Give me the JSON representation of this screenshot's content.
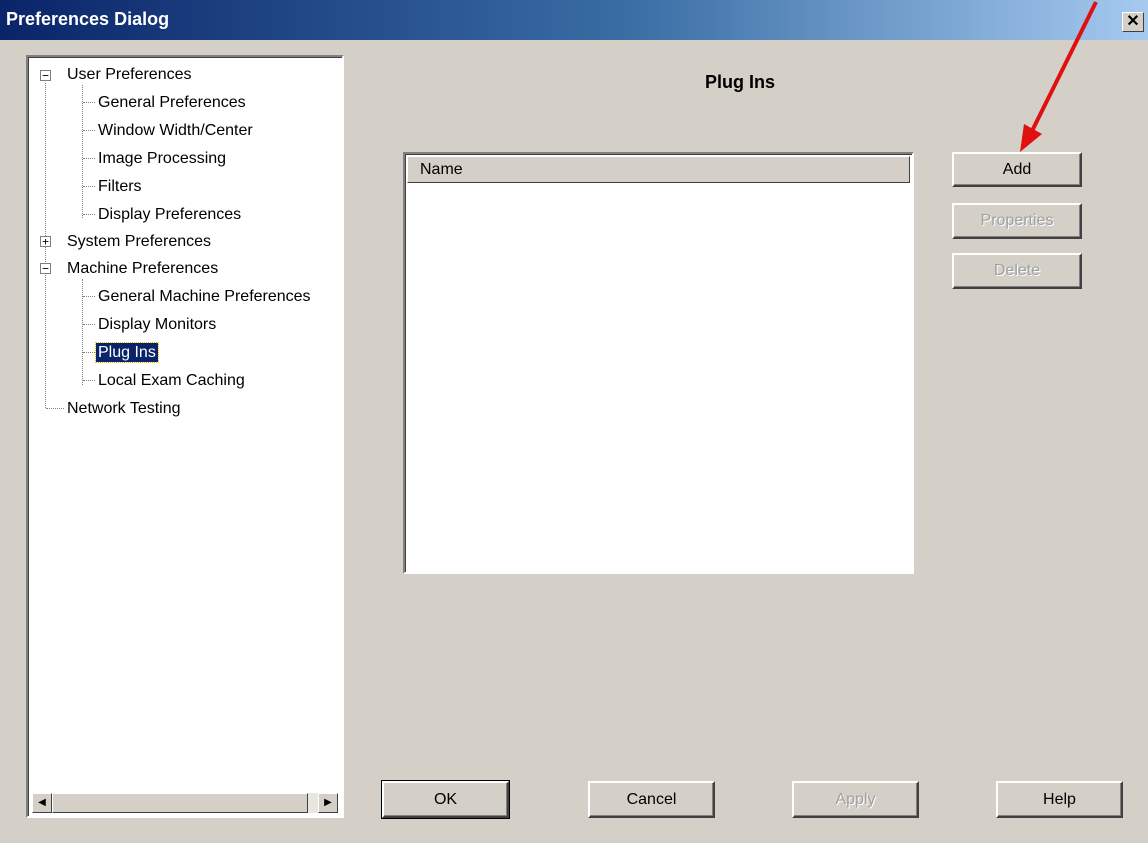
{
  "window": {
    "title": "Preferences Dialog"
  },
  "tree": {
    "items": [
      {
        "label": "User Preferences"
      },
      {
        "label": "General Preferences"
      },
      {
        "label": "Window Width/Center"
      },
      {
        "label": "Image Processing"
      },
      {
        "label": "Filters"
      },
      {
        "label": "Display Preferences"
      },
      {
        "label": "System Preferences"
      },
      {
        "label": "Machine Preferences"
      },
      {
        "label": "General Machine Preferences"
      },
      {
        "label": "Display Monitors"
      },
      {
        "label": "Plug Ins"
      },
      {
        "label": "Local Exam Caching"
      },
      {
        "label": "Network Testing"
      }
    ],
    "selected": "Plug Ins"
  },
  "panel": {
    "title": "Plug Ins",
    "list_header": "Name",
    "buttons": {
      "add": "Add",
      "properties": "Properties",
      "delete": "Delete"
    }
  },
  "footer": {
    "ok": "OK",
    "cancel": "Cancel",
    "apply": "Apply",
    "help": "Help"
  },
  "colors": {
    "titlebar": "#0a246a",
    "face": "#d4d0c8",
    "selection": "#0a246a",
    "annotation_arrow": "#e01010"
  },
  "icons": {
    "close": "close-icon",
    "expand": "plus-box-icon",
    "collapse": "minus-box-icon"
  }
}
